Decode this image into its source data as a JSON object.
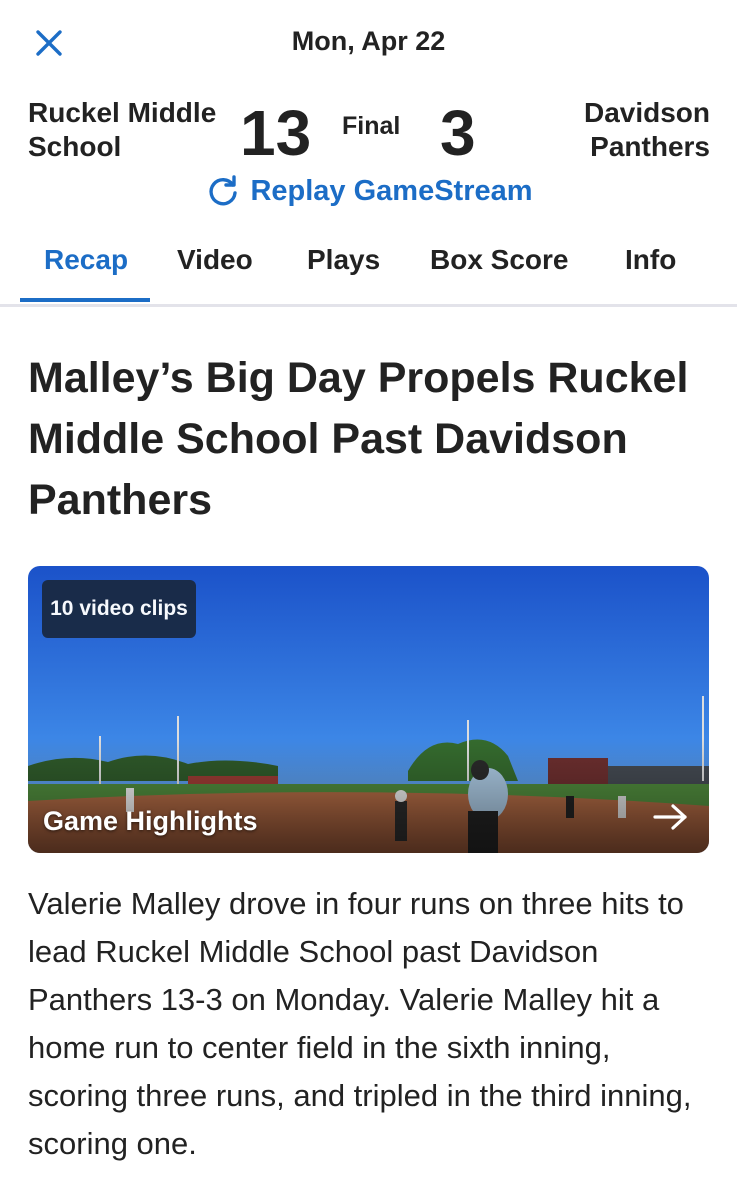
{
  "header": {
    "date": "Mon, Apr 22",
    "close_icon": "close-icon"
  },
  "game": {
    "home_team": "Ruckel Middle School",
    "home_score": "13",
    "status": "Final",
    "away_score": "3",
    "away_team": "Davidson Panthers",
    "replay_label": "Replay GameStream",
    "replay_icon": "refresh-icon"
  },
  "tabs": [
    {
      "label": "Recap",
      "active": true
    },
    {
      "label": "Video",
      "active": false
    },
    {
      "label": "Plays",
      "active": false
    },
    {
      "label": "Box Score",
      "active": false
    },
    {
      "label": "Info",
      "active": false
    }
  ],
  "article": {
    "headline": "Malley’s Big Day Propels Ruckel Middle School Past Davidson Panthers",
    "video": {
      "clip_count_label": "10 video clips",
      "title": "Game Highlights",
      "arrow_icon": "arrow-right-icon"
    },
    "body": "Valerie Malley drove in four runs on three hits to lead Ruckel Middle School past Davidson Panthers 13-3 on Monday. Valerie Malley hit a home run to center field in the sixth inning, scoring three runs, and tripled in the third inning, scoring one."
  },
  "colors": {
    "accent": "#1c6dc6",
    "text": "#222222",
    "badge_bg": "#1a2a44"
  }
}
